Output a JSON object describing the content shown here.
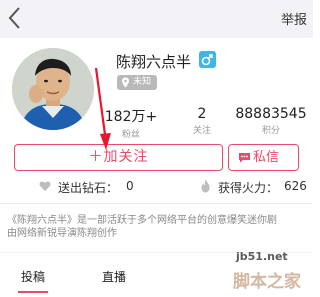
{
  "nav": {
    "report_label": "举报"
  },
  "profile": {
    "name": "陈翔六点半",
    "gender": "male",
    "location": "未知"
  },
  "stats": [
    {
      "value": "182万+",
      "label": "粉丝"
    },
    {
      "value": "2",
      "label": "关注"
    },
    {
      "value": "88883545",
      "label": "积分"
    }
  ],
  "actions": {
    "follow_label": "＋加关注",
    "message_label": "私信"
  },
  "info": {
    "diamond_label": "送出钻石：",
    "diamond_value": "0",
    "fire_label": "获得火力：",
    "fire_value": "626"
  },
  "description": {
    "line1": "《陈翔六点半》是一部活跃于多个网络平台的创意爆笑迷你剧",
    "line2": "由网络新锐导演陈翔创作"
  },
  "tabs": [
    {
      "label": "投稿"
    },
    {
      "label": "直播"
    }
  ],
  "watermark": {
    "url": "jb51.net",
    "logo_text": "脚本之家"
  },
  "colors": {
    "accent": "#e94b6a",
    "gender_badge": "#3fb6e8",
    "nav_bg": "#f3f2f7"
  }
}
